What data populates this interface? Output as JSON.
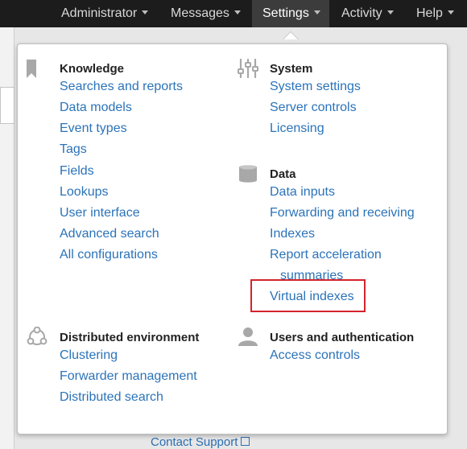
{
  "navbar": {
    "items": [
      "Administrator",
      "Messages",
      "Settings",
      "Activity",
      "Help"
    ],
    "active": "Settings"
  },
  "background": {
    "contact_support": "Contact Support"
  },
  "menu": {
    "knowledge": {
      "title": "Knowledge",
      "icon": "bookmark-icon",
      "links": [
        "Searches and reports",
        "Data models",
        "Event types",
        "Tags",
        "Fields",
        "Lookups",
        "User interface",
        "Advanced search",
        "All configurations"
      ]
    },
    "system": {
      "title": "System",
      "icon": "sliders-icon",
      "links": [
        "System settings",
        "Server controls",
        "Licensing"
      ]
    },
    "data": {
      "title": "Data",
      "icon": "database-icon",
      "links": [
        "Data inputs",
        "Forwarding and receiving",
        "Indexes",
        "Report acceleration",
        "summaries",
        "Virtual indexes"
      ]
    },
    "distributed": {
      "title": "Distributed environment",
      "icon": "network-icon",
      "links": [
        "Clustering",
        "Forwarder management",
        "Distributed search"
      ]
    },
    "users": {
      "title": "Users and authentication",
      "icon": "user-icon",
      "links": [
        "Access controls"
      ]
    }
  },
  "annotation": {
    "highlight_color": "#d3232d",
    "highlighted_item": "Virtual indexes"
  },
  "colors": {
    "nav_bg": "#1c1c1c",
    "link": "#2b73b9",
    "icon": "#a8a8a8"
  }
}
